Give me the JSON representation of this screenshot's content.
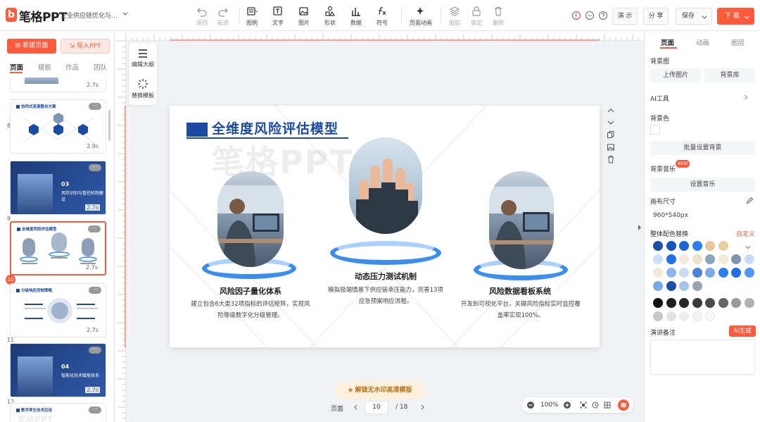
{
  "app": {
    "logo_letter": "b",
    "name": "笔格PPT",
    "doc_title": "企业供应链优化与风险..."
  },
  "toolbar": {
    "tools": [
      {
        "id": "undo",
        "label": "返回",
        "disabled": true
      },
      {
        "id": "redo",
        "label": "前进",
        "disabled": true
      },
      {
        "id": "legend",
        "label": "图例"
      },
      {
        "id": "text",
        "label": "文字"
      },
      {
        "id": "image",
        "label": "图片"
      },
      {
        "id": "shape",
        "label": "形状"
      },
      {
        "id": "data",
        "label": "数据"
      },
      {
        "id": "symbol",
        "label": "符号"
      },
      {
        "id": "page-anim",
        "label": "页面动画"
      },
      {
        "id": "layer",
        "label": "图层",
        "disabled": true
      },
      {
        "id": "lock",
        "label": "锁定",
        "disabled": true
      },
      {
        "id": "delete",
        "label": "删除",
        "disabled": true
      }
    ],
    "present": "演 示",
    "share": "分 享",
    "save": "保存",
    "download": "下 载"
  },
  "left": {
    "new_page": "新建页面",
    "import_ppt": "导入PPT",
    "tabs": [
      "页面",
      "模板",
      "作品",
      "团队"
    ],
    "thumbs": [
      {
        "num": "",
        "duration": "2.7s",
        "kind": "light"
      },
      {
        "num": "8",
        "duration": "2.9s",
        "kind": "light",
        "title": "协同式资源整合方案"
      },
      {
        "num": "9",
        "duration": "2.7s",
        "kind": "dark",
        "big": "03",
        "sub": "风险识别与管控机制建设"
      },
      {
        "num": "10",
        "duration": "2.7s",
        "kind": "light",
        "title": "全维度风险评估模型",
        "active": true
      },
      {
        "num": "11",
        "duration": "2.7s",
        "kind": "light",
        "title": "分级响应控制策略"
      },
      {
        "num": "12",
        "duration": "2.7s",
        "kind": "dark",
        "big": "04",
        "sub": "智能化技术赋能体系"
      },
      {
        "num": "",
        "duration": "",
        "kind": "light",
        "title": "数字孪生技术应用"
      }
    ],
    "more": "···"
  },
  "float_panel": {
    "outline": "编辑大纲",
    "replace": "替换模板"
  },
  "slide": {
    "title": "全维度风险评估模型",
    "watermark": "笔格PPT",
    "items": [
      {
        "heading": "风险因子量化体系",
        "desc": "建立包含6大类32项指标的评估矩阵，实现风险等级数字化分级管理。"
      },
      {
        "heading": "动态压力测试机制",
        "desc": "模拟极端情景下供应链承压能力，完善13项应急预案响应流程。"
      },
      {
        "heading": "风险数据看板系统",
        "desc": "开发BI可视化平台，关键风险指标实时监控覆盖率实现100%。"
      }
    ]
  },
  "bottom": {
    "unlock": "解锁无水印高清模版",
    "page_label": "页面",
    "page_current": "10",
    "page_total": "/ 18",
    "zoom": "100%"
  },
  "right": {
    "tabs": [
      "页面",
      "动画",
      "图层"
    ],
    "bg_image": "背景图",
    "upload_img": "上传图片",
    "bg_library": "背景库",
    "ai_tools": "AI工具",
    "bg_color": "背景色",
    "batch_bg": "批量设置背景",
    "bg_music": "背景音乐",
    "new_badge": "NEW",
    "set_music": "设置音乐",
    "canvas_size": "画布尺寸",
    "canvas_value": "960*540px",
    "theme_color": "整体配色替换",
    "customize": "自定义",
    "notes": "演讲备注",
    "ai_gen": "AI生成",
    "palette": [
      [
        "#1c4fa8",
        "#1456c2",
        "#1e66d6",
        "#2a7ff0",
        "#e7c89a",
        "#e8cfa0"
      ],
      [
        "#cfe0f6",
        "#1e6fe8",
        "#f4eadc",
        "#efe2cc",
        "#8da4bd",
        "#f3ead8",
        "#7d93ae",
        "#c7dcf5"
      ],
      [
        "#f4eadc",
        "#8ab7ef",
        "#c9dbf3",
        "#4a84d8",
        "#7ea9e6",
        "#2a7ff0",
        "#1e6fe8",
        "#4f97f2"
      ],
      [
        "#7aa9ea",
        "#1c4fa8",
        "#a6c4ea",
        "#9aa4ae"
      ],
      [
        "#111111",
        "#1e1e1e",
        "#2a2a2a",
        "#3a3a3a",
        "#4a4a4a",
        "#666666",
        "#9a9a9a",
        "#b0b0b0"
      ],
      [
        "#c8c8c8",
        "#e3e3e3",
        "#eeeeee",
        "#f3f3f3",
        "#f8f8f8"
      ]
    ]
  }
}
